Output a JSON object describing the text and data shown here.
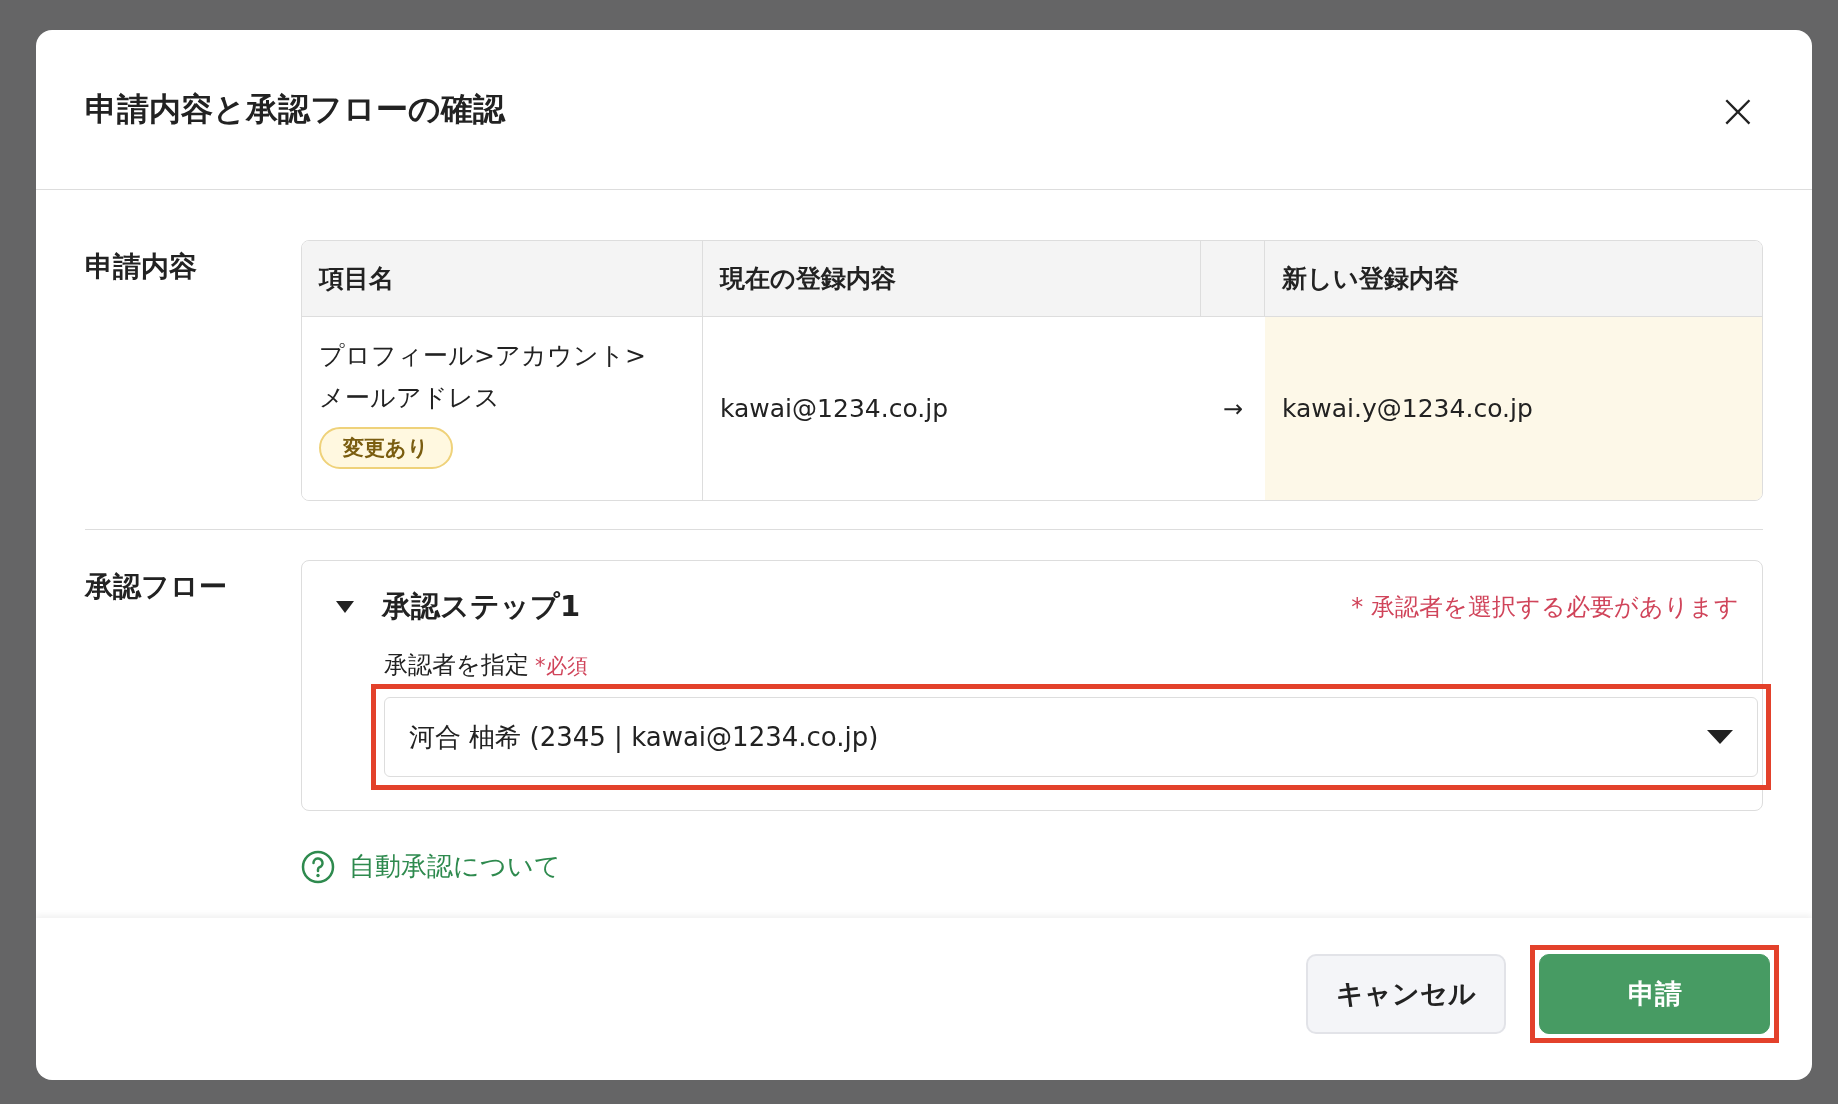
{
  "dialog": {
    "title": "申請内容と承認フローの確認",
    "close_icon": "×"
  },
  "request": {
    "label": "申請内容",
    "columns": [
      "項目名",
      "現在の登録内容",
      "新しい登録内容"
    ],
    "rows": [
      {
        "item_lines": [
          "プロフィール>アカウント>",
          "メールアドレス"
        ],
        "badge": "変更あり",
        "current": "kawai@1234.co.jp",
        "arrow": "→",
        "new": "kawai.y@1234.co.jp"
      }
    ]
  },
  "flow": {
    "label": "承認フロー",
    "steps": [
      {
        "title": "承認ステップ1",
        "expanded": true,
        "error": "* 承認者を選択する必要があります",
        "field_label": "承認者を指定",
        "required": "*必須",
        "value": "河合 柚希 (2345 | kawai@1234.co.jp)",
        "highlighted": true
      }
    ],
    "help_link": "自動承認について"
  },
  "buttons": [
    {
      "label": "キャンセル",
      "kind": "secondary",
      "highlighted": false
    },
    {
      "label": "申請",
      "kind": "primary",
      "highlighted": true
    }
  ]
}
